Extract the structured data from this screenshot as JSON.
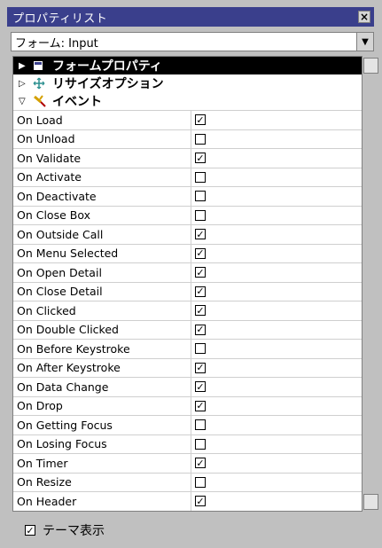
{
  "window": {
    "title": "プロパティリスト",
    "close_label": "×"
  },
  "selector": {
    "value": "フォーム: Input"
  },
  "groups": [
    {
      "label": "フォームプロパティ",
      "expanded": false
    },
    {
      "label": "リサイズオプション",
      "expanded": false
    },
    {
      "label": "イベント",
      "expanded": true
    }
  ],
  "events": [
    {
      "label": "On Load",
      "checked": true
    },
    {
      "label": "On Unload",
      "checked": false
    },
    {
      "label": "On Validate",
      "checked": true
    },
    {
      "label": "On Activate",
      "checked": false
    },
    {
      "label": "On Deactivate",
      "checked": false
    },
    {
      "label": "On Close Box",
      "checked": false
    },
    {
      "label": "On Outside Call",
      "checked": true
    },
    {
      "label": "On Menu Selected",
      "checked": true
    },
    {
      "label": "On Open Detail",
      "checked": true
    },
    {
      "label": "On Close Detail",
      "checked": true
    },
    {
      "label": "On Clicked",
      "checked": true
    },
    {
      "label": "On Double Clicked",
      "checked": true
    },
    {
      "label": "On Before Keystroke",
      "checked": false
    },
    {
      "label": "On After Keystroke",
      "checked": true
    },
    {
      "label": "On Data Change",
      "checked": true
    },
    {
      "label": "On Drop",
      "checked": true
    },
    {
      "label": "On Getting Focus",
      "checked": false
    },
    {
      "label": "On Losing Focus",
      "checked": false
    },
    {
      "label": "On Timer",
      "checked": true
    },
    {
      "label": "On Resize",
      "checked": false
    },
    {
      "label": "On Header",
      "checked": true
    }
  ],
  "footer": {
    "label": "テーマ表示",
    "checked": true
  },
  "colors": {
    "titlebar": "#3a3f8c",
    "group_highlight": "#000000"
  }
}
